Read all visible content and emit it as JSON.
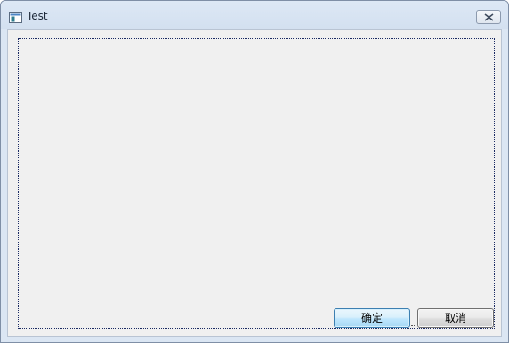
{
  "window": {
    "title": "Test"
  },
  "dialog": {
    "ok_label": "确定",
    "cancel_label": "取消"
  },
  "icons": {
    "app": "window-app-icon",
    "close": "close-icon"
  },
  "colors": {
    "titlebar": "#d3e0f0",
    "client_background": "#f0f0f0",
    "focus_outline": "#1b2a63",
    "ok_button_border": "#3c7fb1"
  }
}
